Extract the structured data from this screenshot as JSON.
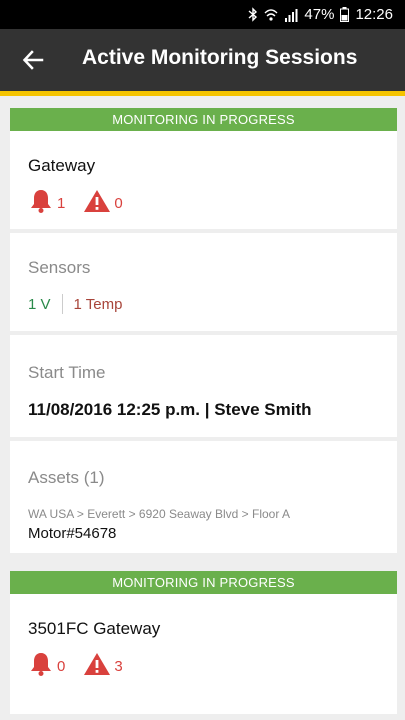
{
  "status_bar": {
    "battery_percent": "47%",
    "time": "12:26",
    "icons": [
      "bluetooth-icon",
      "wifi-icon",
      "signal-icon",
      "battery-icon"
    ]
  },
  "header": {
    "title": "Active Monitoring Sessions",
    "back_icon": "back-arrow-icon"
  },
  "colors": {
    "accent": "#f5c400",
    "banner": "#6ab04c",
    "alert": "#d9413d",
    "sensor_v": "#2a8a4a",
    "sensor_temp": "#a8453a"
  },
  "sessions": [
    {
      "banner": "MONITORING IN PROGRESS",
      "gateway_name": "Gateway",
      "alarm_count": "1",
      "warning_count": "0",
      "sensors_label": "Sensors",
      "sensor_v": "1 V",
      "sensor_temp": "1 Temp",
      "start_label": "Start Time",
      "start_value": "11/08/2016 12:25 p.m. | Steve Smith",
      "assets_label": "Assets (1)",
      "asset_path": "WA USA > Everett > 6920 Seaway Blvd > Floor A",
      "asset_name": "Motor#54678"
    },
    {
      "banner": "MONITORING IN PROGRESS",
      "gateway_name": "3501FC Gateway",
      "alarm_count": "0",
      "warning_count": "3"
    }
  ]
}
